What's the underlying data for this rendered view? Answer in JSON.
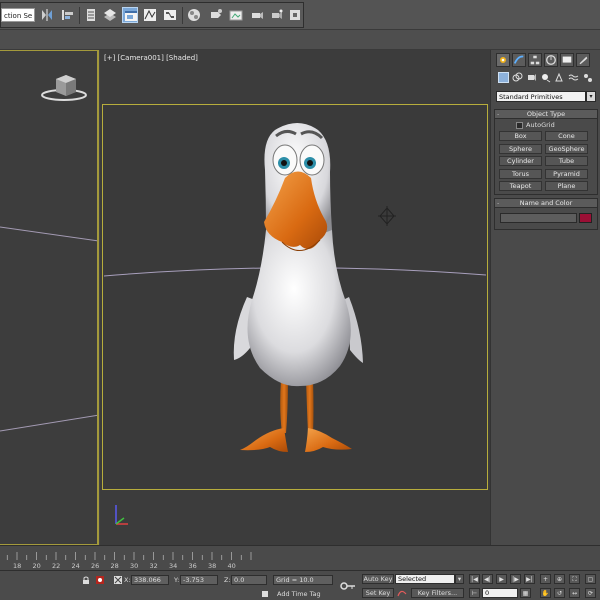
{
  "toolbar": {
    "selection_filter_value": "ction Se",
    "icons": [
      "mirror-icon",
      "align-icon",
      "layer-manager-icon",
      "graphite-tools-icon",
      "scene-explorer-icon",
      "curve-editor-icon",
      "schematic-view-icon",
      "material-editor-icon",
      "render-setup-icon",
      "rendered-frame-icon",
      "render-icon",
      "render-production-icon"
    ]
  },
  "viewport": {
    "label": "[+] [Camera001] [Shaded]"
  },
  "command_panel": {
    "tabs": [
      "create-tab",
      "modify-tab",
      "hierarchy-tab",
      "motion-tab",
      "display-tab",
      "utilities-tab"
    ],
    "category_icons": [
      "geometry-icon",
      "shapes-icon",
      "lights-icon",
      "cameras-icon",
      "helpers-icon",
      "space-warps-icon",
      "systems-icon"
    ],
    "dropdown_value": "Standard Primitives",
    "object_type": {
      "title": "Object Type",
      "autogrid_label": "AutoGrid",
      "buttons": [
        "Box",
        "Cone",
        "Sphere",
        "GeoSphere",
        "Cylinder",
        "Tube",
        "Torus",
        "Pyramid",
        "Teapot",
        "Plane"
      ]
    },
    "name_color": {
      "title": "Name and Color",
      "name_value": "",
      "color": "#9b0f35"
    }
  },
  "timeline": {
    "ticks": [
      "18",
      "20",
      "22",
      "24",
      "26",
      "28",
      "30",
      "32",
      "34",
      "36",
      "38",
      "40"
    ]
  },
  "status_bar": {
    "x_label": "X:",
    "x_value": "338.066",
    "y_label": "Y:",
    "y_value": "-3.753",
    "z_label": "Z:",
    "z_value": "0.0",
    "grid_text": "Grid = 10.0",
    "add_time_tag": "Add Time Tag",
    "auto_key": "Auto Key",
    "set_key": "Set Key",
    "selected_value": "Selected",
    "key_filters": "Key Filters...",
    "frame_value": "0"
  },
  "colors": {
    "viewport_border": "#b7ad3c",
    "toolbar_active": "#7aa7d8",
    "swatch": "#9b0f35",
    "bird_beak": "#e2731a"
  }
}
